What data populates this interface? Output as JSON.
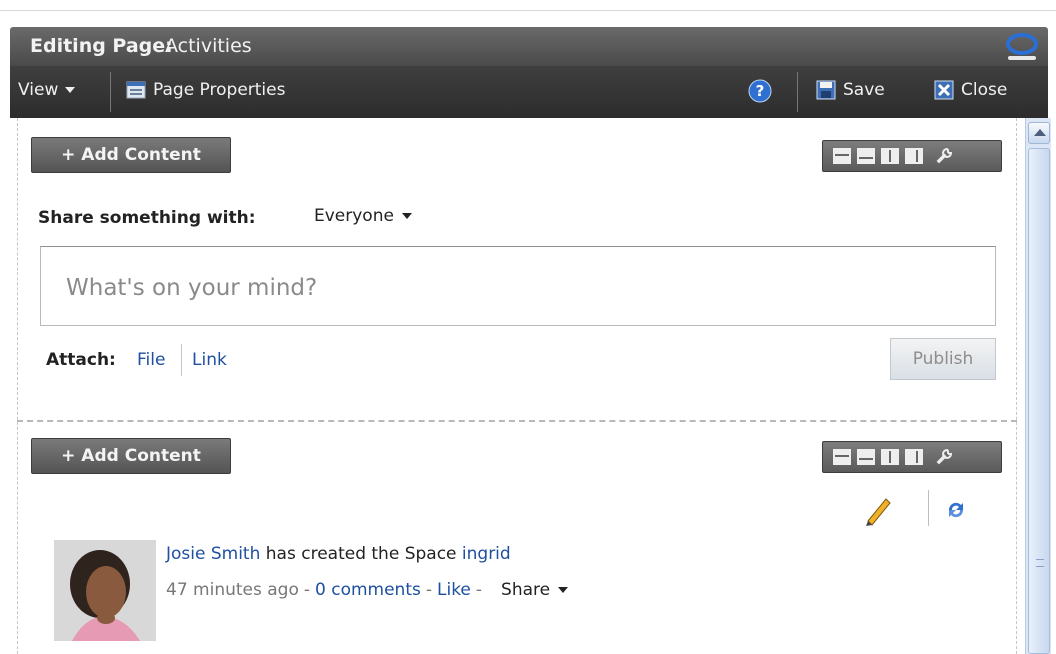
{
  "header": {
    "editing_label": "Editing Page:",
    "page_name": "Activities"
  },
  "toolbar": {
    "view_label": "View",
    "page_properties_label": "Page Properties",
    "save_label": "Save",
    "close_label": "Close"
  },
  "section1": {
    "add_content_label": "+ Add Content",
    "share_label": "Share something with:",
    "share_target": "Everyone",
    "input_placeholder": "What's on your mind?",
    "attach_label": "Attach:",
    "attach_file": "File",
    "attach_link": "Link",
    "publish_label": "Publish"
  },
  "section2": {
    "add_content_label": "+ Add Content",
    "activity": {
      "user": "Josie Smith",
      "text": "has created the Space",
      "space": "ingrid",
      "time": "47 minutes ago",
      "sep": "-",
      "comments": "0 comments",
      "like": "Like",
      "share": "Share"
    }
  },
  "colors": {
    "link": "#1f4fa0",
    "titlebar": "#5a5a5a",
    "toolbar": "#353535",
    "help_icon": "#f0a020",
    "save_icon": "#3c6fb5",
    "close_icon": "#3c6fb5"
  }
}
